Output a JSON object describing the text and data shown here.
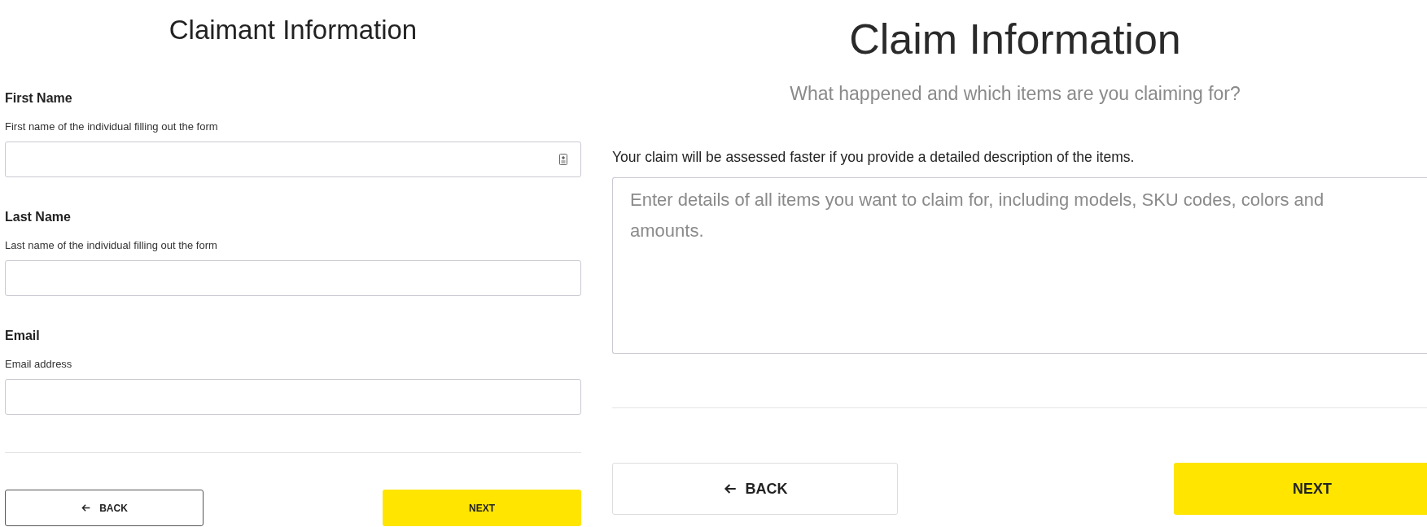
{
  "claimant_form": {
    "title": "Claimant Information",
    "fields": [
      {
        "label": "First Name",
        "help": "First name of the individual filling out the form",
        "autofill_icon": true
      },
      {
        "label": "Last Name",
        "help": "Last name of the individual filling out the form",
        "autofill_icon": false
      },
      {
        "label": "Email",
        "help": "Email address",
        "autofill_icon": false
      }
    ],
    "buttons": [
      {
        "kind": "back",
        "label": "BACK"
      },
      {
        "kind": "next",
        "label": "NEXT"
      }
    ]
  },
  "claim_form": {
    "title": "Claim Information",
    "subtitle": "What happened and which items are you claiming for?",
    "note": "Your claim will be assessed faster if you provide a detailed description of the items.",
    "details": {
      "placeholder": "Enter details of all items you want to claim for, including models, SKU codes, colors and amounts."
    },
    "buttons": [
      {
        "kind": "back",
        "label": "BACK"
      },
      {
        "kind": "next",
        "label": "NEXT"
      }
    ]
  }
}
